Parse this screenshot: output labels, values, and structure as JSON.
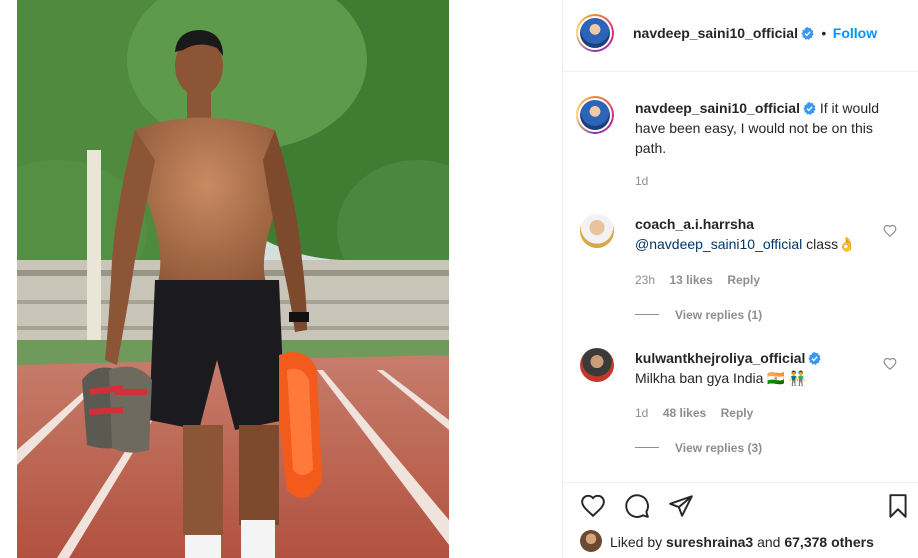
{
  "post": {
    "username": "navdeep_saini10_official",
    "follow_separator": "•",
    "follow_label": "Follow",
    "caption": "If it would have been easy, I would not be on this path.",
    "caption_line1": "If it would",
    "caption_line2": "have been easy, I would not be on this",
    "caption_line3": "path.",
    "age": "1d"
  },
  "comments": [
    {
      "username": "coach_a.i.harrsha",
      "mention": "@navdeep_saini10_official",
      "text": " class👌",
      "age": "23h",
      "likes": "13 likes",
      "reply": "Reply",
      "view_replies": "View replies (1)",
      "verified": false
    },
    {
      "username": "kulwantkhejroliya_official",
      "text": "Milkha ban gya India 🇮🇳 👬",
      "age": "1d",
      "likes": "48 likes",
      "reply": "Reply",
      "view_replies": "View replies (3)",
      "verified": true
    }
  ],
  "likes": {
    "prefix": "Liked by",
    "user": "sureshraina3",
    "joiner": "and",
    "others": "67,378 others"
  },
  "icons": {
    "like": "heart-icon",
    "comment": "comment-icon",
    "share": "paper-plane-icon",
    "save": "bookmark-icon",
    "verified": "verified-badge-icon",
    "comment_like": "small-heart-icon"
  },
  "colors": {
    "link_blue": "#0095f6",
    "verified_blue": "#3897f0",
    "text": "#262626",
    "muted": "#8e8e8e",
    "divider": "#efefef"
  }
}
